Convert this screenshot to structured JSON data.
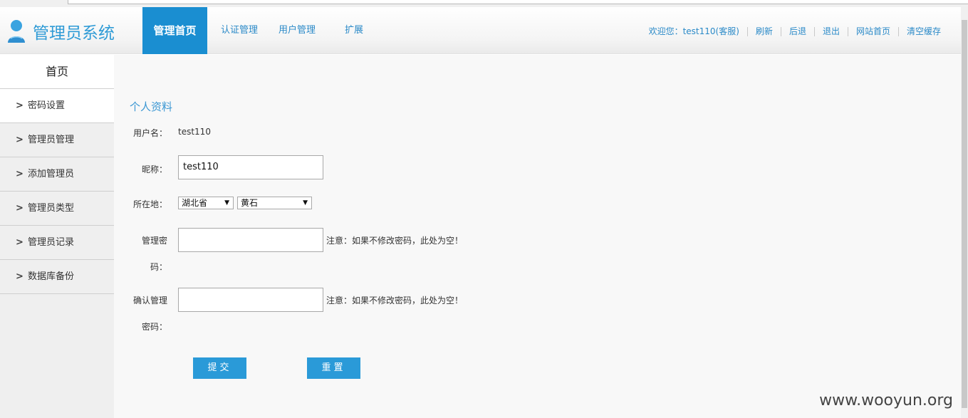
{
  "app": {
    "title": "管理员系统"
  },
  "nav": [
    {
      "label": "管理首页",
      "active": true
    },
    {
      "label": "认证管理"
    },
    {
      "label": "用户管理"
    },
    {
      "label": "扩展"
    }
  ],
  "top_links": [
    "欢迎您：test110(客服)",
    "刷新",
    "后退",
    "退出",
    "网站首页",
    "清空缓存"
  ],
  "sidebar": {
    "home": "首页",
    "items": [
      {
        "label": "密码设置",
        "active": true
      },
      {
        "label": "管理员管理"
      },
      {
        "label": "添加管理员"
      },
      {
        "label": "管理员类型"
      },
      {
        "label": "管理员记录"
      },
      {
        "label": "数据库备份"
      }
    ]
  },
  "profile": {
    "title": "个人资料",
    "username_label": "用户名：",
    "username_value": "test110",
    "nickname_label": "昵称：",
    "nickname_value": "test110",
    "location_label": "所在地：",
    "province": "湖北省",
    "city": "黄石",
    "password_label_1": "管理密",
    "password_label_2": "码：",
    "password_note": "注意：如果不修改密码，此处为空！",
    "confirm_label_1": "确认管理",
    "confirm_label_2": "密码：",
    "confirm_note": "注意：如果不修改密码，此处为空！",
    "submit_label": "提交",
    "reset_label": "重置"
  },
  "watermark": "www.wooyun.org",
  "colors": {
    "accent": "#1a8ed1",
    "link": "#2b8ac8",
    "button": "#2a9ad8"
  }
}
